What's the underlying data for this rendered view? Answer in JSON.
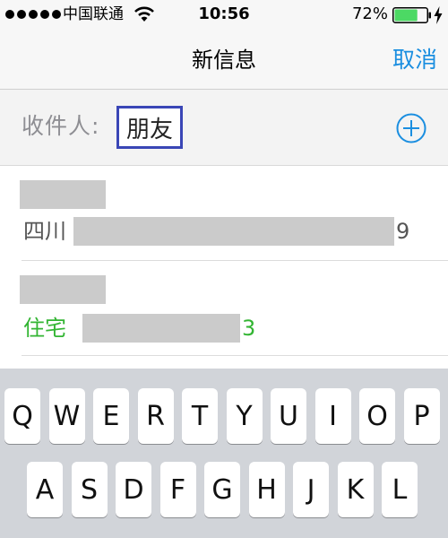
{
  "status_bar": {
    "carrier": "中国联通",
    "time": "10:56",
    "battery_percent": "72%",
    "battery_level": 0.72,
    "battery_color": "#4cd964",
    "signal_icon": "signal-dots-icon",
    "wifi_icon": "wifi-icon",
    "charge_icon": "charging-bolt-icon"
  },
  "nav": {
    "title": "新信息",
    "cancel_label": "取消",
    "accent_color": "#1a8ee0"
  },
  "recipient": {
    "label": "收件人:",
    "value": "朋友",
    "add_icon": "add-circle-icon"
  },
  "suggestions": [
    {
      "label": "四川",
      "value_suffix": "9"
    },
    {
      "label": "住宅",
      "value_suffix": "3",
      "color": "#33b533"
    }
  ],
  "keyboard": {
    "row1": [
      "Q",
      "W",
      "E",
      "R",
      "T",
      "Y",
      "U",
      "I",
      "O",
      "P"
    ],
    "row2": [
      "A",
      "S",
      "D",
      "F",
      "G",
      "H",
      "J",
      "K",
      "L"
    ]
  }
}
